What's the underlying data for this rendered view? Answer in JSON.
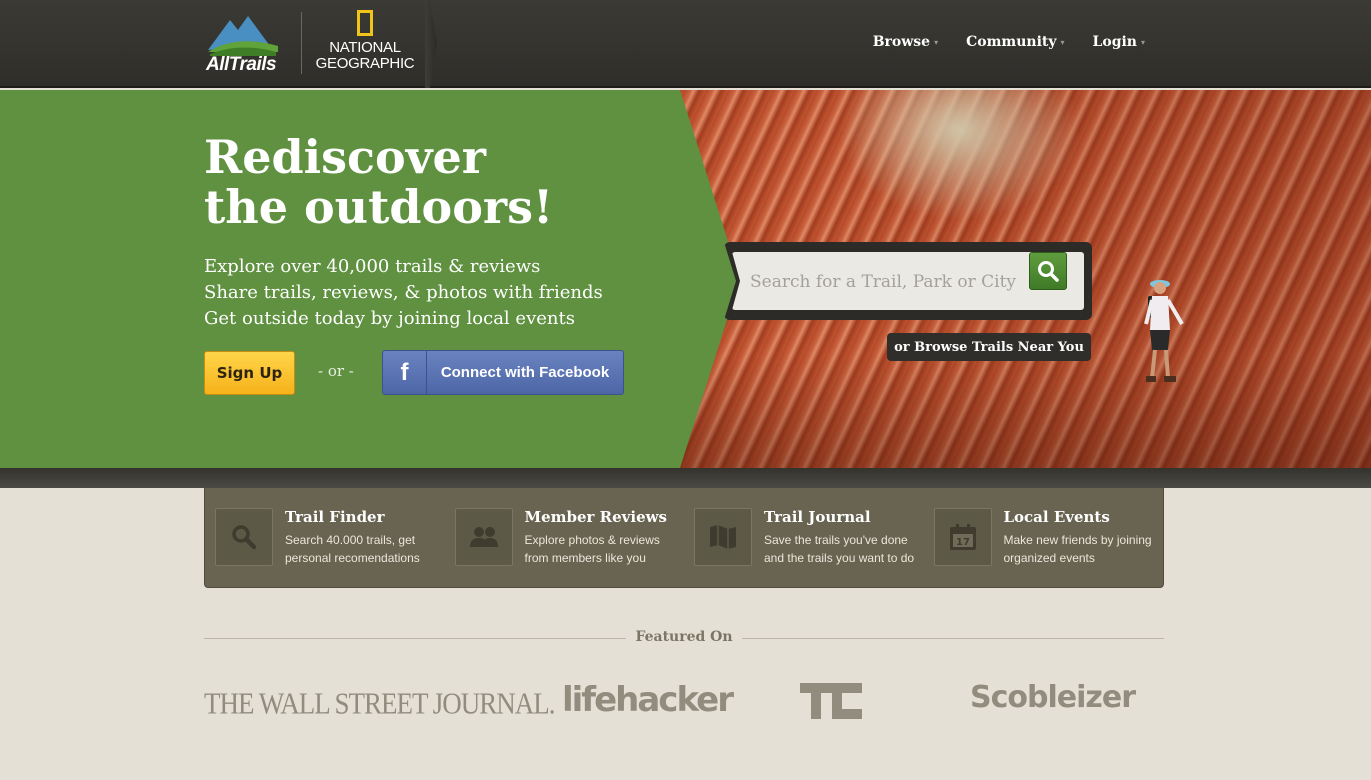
{
  "header": {
    "brand_alltrails": "AllTrails",
    "brand_natgeo_line1": "NATIONAL",
    "brand_natgeo_line2": "GEOGRAPHIC",
    "nav": [
      {
        "label": "Browse"
      },
      {
        "label": "Community"
      },
      {
        "label": "Login"
      }
    ]
  },
  "hero": {
    "title_line1": "Rediscover",
    "title_line2": "the outdoors!",
    "lines": [
      "Explore over 40,000 trails & reviews",
      "Share trails, reviews, & photos with friends",
      "Get outside today by joining local events"
    ],
    "signup_label": "Sign Up",
    "or_text": "- or -",
    "facebook_icon": "f",
    "facebook_label": "Connect with Facebook"
  },
  "search": {
    "placeholder": "Search for a Trail, Park or City",
    "icon": "search-icon",
    "browse_near_label": "or Browse Trails Near You"
  },
  "features": [
    {
      "icon": "magnifier-icon",
      "title": "Trail Finder",
      "desc": "Search 40.000 trails, get personal recomendations"
    },
    {
      "icon": "people-icon",
      "title": "Member Reviews",
      "desc": "Explore photos & reviews from members like you"
    },
    {
      "icon": "map-icon",
      "title": "Trail Journal",
      "desc": "Save the trails you've done and the trails you want to do"
    },
    {
      "icon": "calendar-icon",
      "title": "Local Events",
      "desc": "Make new friends by joining organized events",
      "calendar_day": "17"
    }
  ],
  "featured_on": {
    "label": "Featured On",
    "press": [
      {
        "name": "THE WALL STREET JOURNAL."
      },
      {
        "name": "lifehacker"
      },
      {
        "name": "TC"
      },
      {
        "name": "Scobleizer"
      }
    ]
  },
  "colors": {
    "hero_green": "#5f9141",
    "header_dark": "#3b3a35",
    "feature_panel": "#686451",
    "signup_yellow": "#f6b21a",
    "facebook_blue": "#4d66a6"
  }
}
